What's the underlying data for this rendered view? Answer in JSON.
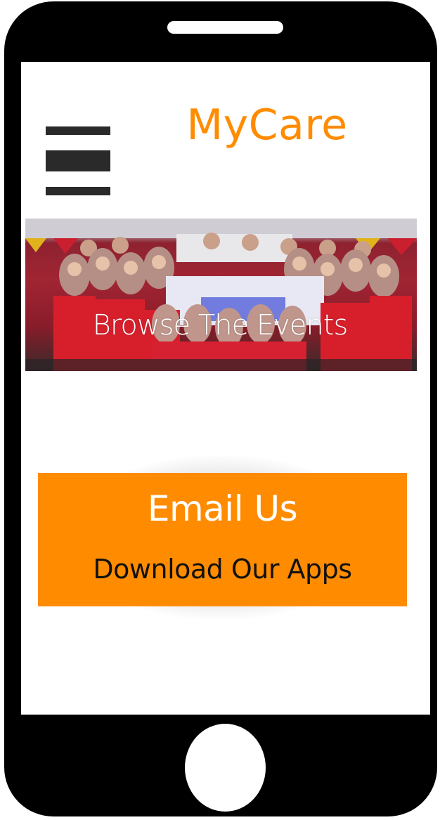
{
  "header": {
    "app_title": "MyCare",
    "menu_icon": "hamburger-menu-icon"
  },
  "banner": {
    "caption": "Browse The Events"
  },
  "cta": {
    "email_label": "Email Us",
    "download_label": "Download Our Apps"
  },
  "colors": {
    "accent": "#ff8c00",
    "device_frame": "#000000",
    "screen_background": "#ffffff"
  }
}
